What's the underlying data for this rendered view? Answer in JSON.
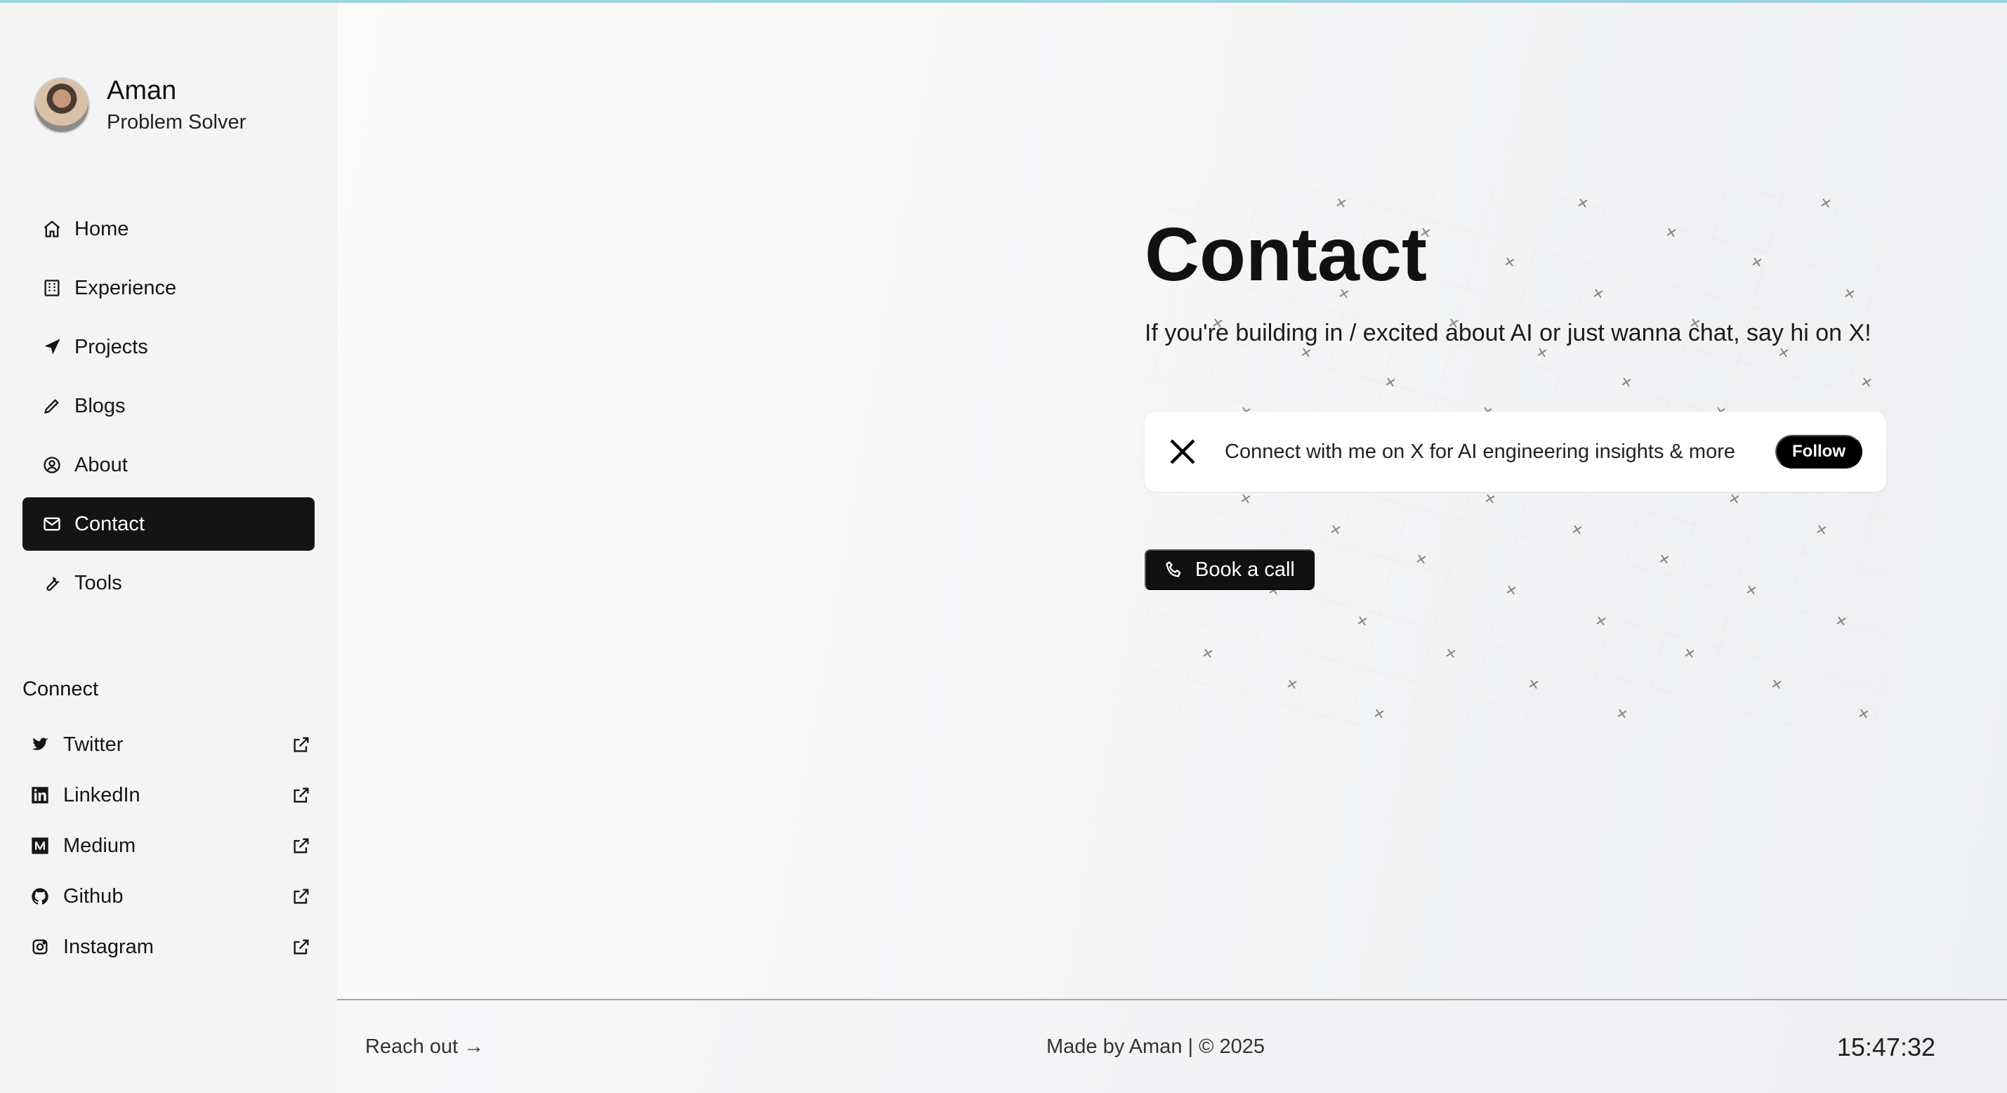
{
  "profile": {
    "name": "Aman",
    "role": "Problem Solver"
  },
  "nav": {
    "items": [
      {
        "label": "Home",
        "icon": "home-icon",
        "active": false
      },
      {
        "label": "Experience",
        "icon": "building-icon",
        "active": false
      },
      {
        "label": "Projects",
        "icon": "navigation-arrow-icon",
        "active": false
      },
      {
        "label": "Blogs",
        "icon": "pen-icon",
        "active": false
      },
      {
        "label": "About",
        "icon": "user-circle-icon",
        "active": false
      },
      {
        "label": "Contact",
        "icon": "mail-icon",
        "active": true
      },
      {
        "label": "Tools",
        "icon": "wrench-icon",
        "active": false
      }
    ]
  },
  "connect": {
    "title": "Connect",
    "items": [
      {
        "label": "Twitter",
        "icon": "twitter-icon"
      },
      {
        "label": "LinkedIn",
        "icon": "linkedin-icon"
      },
      {
        "label": "Medium",
        "icon": "medium-icon"
      },
      {
        "label": "Github",
        "icon": "github-icon"
      },
      {
        "label": "Instagram",
        "icon": "instagram-icon"
      }
    ],
    "external_icon": "external-link-icon"
  },
  "main": {
    "title": "Contact",
    "lead": "If you're building in / excited about AI or just wanna chat, say hi on X!",
    "x_card": {
      "text": "Connect with me on X for AI engineering insights & more",
      "follow_label": "Follow",
      "icon": "x-logo-icon"
    },
    "book_button": {
      "label": "Book a call",
      "icon": "phone-icon"
    }
  },
  "footer": {
    "reach_out": "Reach out →",
    "made_by": "Made by Aman | © 2025",
    "time": "15:47:32"
  },
  "colors": {
    "accent": "#141414",
    "background": "#f3f3f4",
    "top_line": "#9fd3d9"
  }
}
